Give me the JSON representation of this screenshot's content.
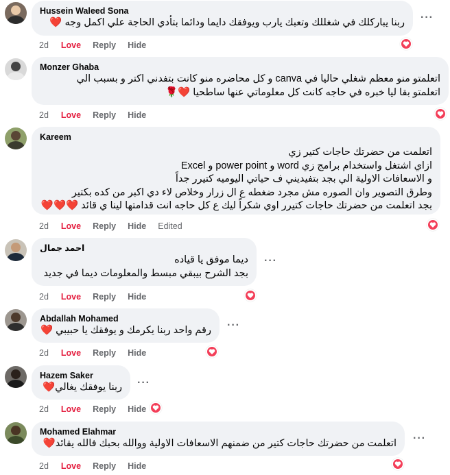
{
  "actions": {
    "love": "Love",
    "reply": "Reply",
    "hide": "Hide",
    "edited": "Edited"
  },
  "comments": [
    {
      "author": "Hussein Waleed Sona",
      "text": "ربنا يباركلك في شغللك وتعبك يارب ويوفقك دايما ودائما بتأدي الحاجة علي اكمل وجه ❤️",
      "time": "2d",
      "edited": false,
      "reaction": "love-reaction-icon"
    },
    {
      "author": "Monzer Ghaba",
      "text": "اتعلمتو منو معظم شغلي حاليا في canva و كل محاضره منو كانت بتفدني اكتر و بسبب الي\nاتعلمتو بقا ليا خبره في حاجه كانت كل معلوماتي عنها ساطحيا ❤️🌹",
      "time": "2d",
      "edited": false,
      "reaction": "love-reaction-icon"
    },
    {
      "author": "Kareem",
      "text": "اتعلمت من حضرتك حاجات كتير زي\nازاي اشتغل واستخدام برامج زي word و power point و Excel\nو الاسعافات الاولية الي بجد بتفيديني ف حياتي اليوميه كتيرر جداً\nوطرق التصوير وان الصوره مش مجرد ضغطه ع ال زرار وخلاص لاء دي اكبر من كده بكتير\nبجد اتعلمت من حضرتك حاجات كتيرر اوي شكراً ليك ع كل حاجه انت قدامتها لينا ي قائد ❤️❤️❤️",
      "time": "2d",
      "edited": true,
      "reaction": "love-reaction-icon"
    },
    {
      "author": "احمد جمال",
      "text": "ديما موفق يا قياده\nبجد الشرح بيبقي مبسط والمعلومات ديما في جديد",
      "time": "2d",
      "edited": false,
      "reaction": "love-reaction-icon"
    },
    {
      "author": "Abdallah Mohamed",
      "text": "رقم واحد ربنا يكرمك و يوفقك يا حبيبي ❤️",
      "time": "2d",
      "edited": false,
      "reaction": "love-reaction-icon"
    },
    {
      "author": "Hazem Saker",
      "text": "ربنا يوفقك يغالي❤️",
      "time": "2d",
      "edited": false,
      "reaction": "love-reaction-icon"
    },
    {
      "author": "Mohamed Elahmar",
      "text": "اتعلمت من حضرتك حاجات كتير من ضمنهم الاسعافات الاولية ووالله بحبك فالله يقائد❤️",
      "time": "2d",
      "edited": false,
      "reaction": "love-reaction-icon"
    }
  ],
  "colors": {
    "accent_love": "#e41e3f",
    "bubble": "#f0f2f5",
    "meta_text": "#65676b"
  }
}
